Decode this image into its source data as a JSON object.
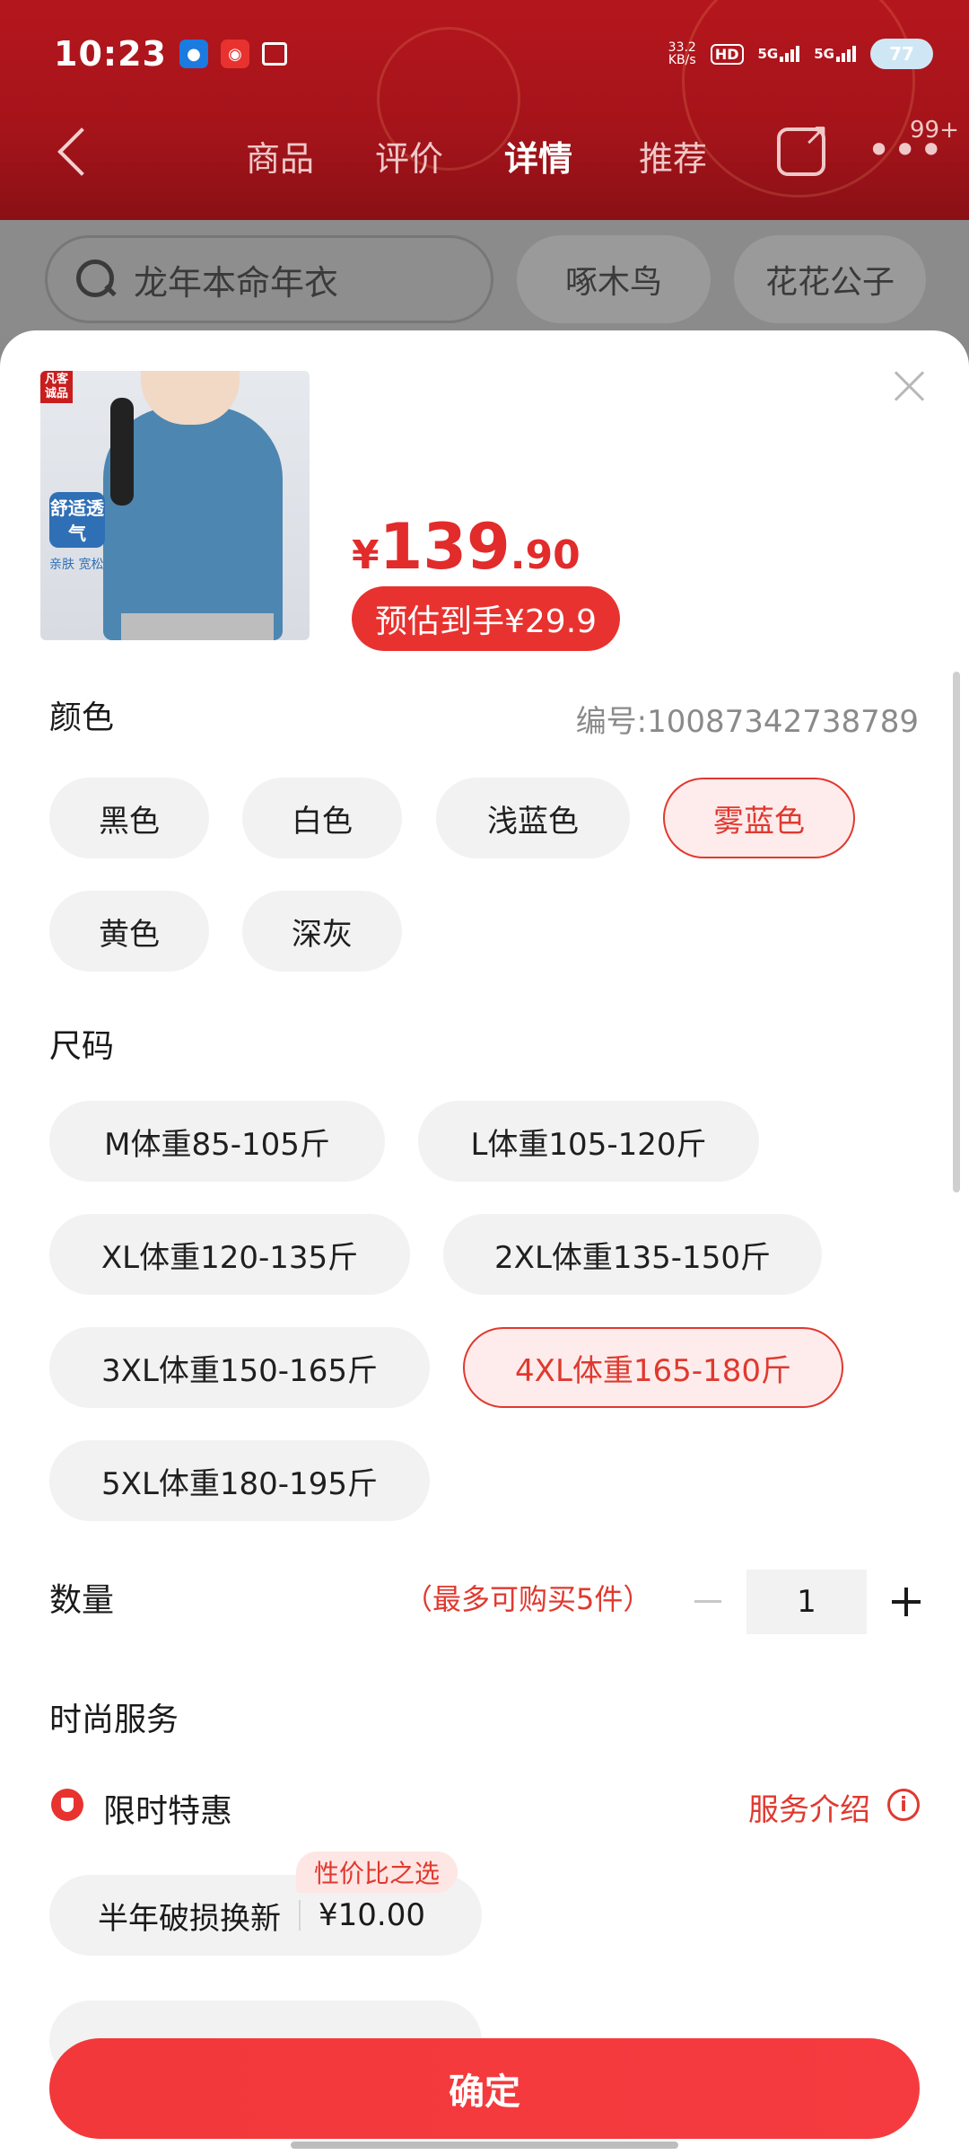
{
  "status": {
    "time": "10:23",
    "net_speed": "33.2",
    "net_unit": "KB/s",
    "hd": "HD",
    "sig1": "5G",
    "sig2": "5G",
    "battery": "77"
  },
  "nav": {
    "tabs": [
      "商品",
      "评价",
      "详情",
      "推荐"
    ],
    "active_tab": "详情",
    "badge": "99+"
  },
  "search": {
    "placeholder": "龙年本命年衣",
    "chips": [
      "啄木鸟",
      "花花公子"
    ]
  },
  "product": {
    "thumb_tag": "凡客诚品",
    "thumb_label": "舒适透气",
    "thumb_sub": "亲肤 宽松",
    "price_symbol": "¥",
    "price_int": "139",
    "price_dec": ".90",
    "estimate": "预估到手¥29.9",
    "code": "编号:10087342738789"
  },
  "color": {
    "title": "颜色",
    "options": [
      "黑色",
      "白色",
      "浅蓝色",
      "雾蓝色",
      "黄色",
      "深灰"
    ],
    "selected": "雾蓝色"
  },
  "size": {
    "title": "尺码",
    "options": [
      "M体重85-105斤",
      "L体重105-120斤",
      "XL体重120-135斤",
      "2XL体重135-150斤",
      "3XL体重150-165斤",
      "4XL体重165-180斤",
      "5XL体重180-195斤"
    ],
    "selected": "4XL体重165-180斤"
  },
  "quantity": {
    "title": "数量",
    "limit": "（最多可购买5件）",
    "value": "1"
  },
  "service": {
    "title": "时尚服务",
    "name": "限时特惠",
    "link": "服务介绍",
    "option_name": "半年破损换新",
    "option_price": "¥10.00",
    "option_tag": "性价比之选"
  },
  "confirm_label": "确定",
  "colors": {
    "accent": "#e0392f",
    "header_red": "#b5161d"
  }
}
